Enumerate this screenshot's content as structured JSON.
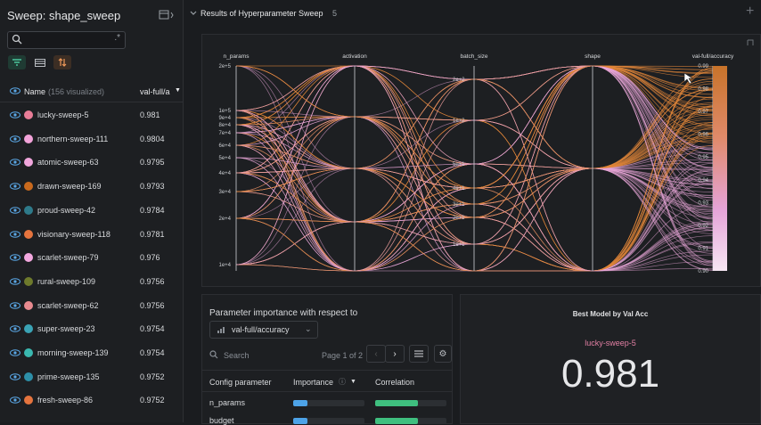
{
  "sidebar": {
    "title": "Sweep: shape_sweep",
    "col_name": "Name",
    "col_visualized": "(156 visualized)",
    "col_metric": "val-full/a",
    "runs": [
      {
        "name": "lucky-sweep-5",
        "value": "0.981",
        "color": "#e87d97"
      },
      {
        "name": "northern-sweep-111",
        "value": "0.9804",
        "color": "#f2a3d9"
      },
      {
        "name": "atomic-sweep-63",
        "value": "0.9795",
        "color": "#f0a6dc"
      },
      {
        "name": "drawn-sweep-169",
        "value": "0.9793",
        "color": "#c8691d"
      },
      {
        "name": "proud-sweep-42",
        "value": "0.9784",
        "color": "#2e7a8a"
      },
      {
        "name": "visionary-sweep-118",
        "value": "0.9781",
        "color": "#e5743e"
      },
      {
        "name": "scarlet-sweep-79",
        "value": "0.976",
        "color": "#f3a8df"
      },
      {
        "name": "rural-sweep-109",
        "value": "0.9756",
        "color": "#6e7a2c"
      },
      {
        "name": "scarlet-sweep-62",
        "value": "0.9756",
        "color": "#e88a8f"
      },
      {
        "name": "super-sweep-23",
        "value": "0.9754",
        "color": "#3aa3b5"
      },
      {
        "name": "morning-sweep-139",
        "value": "0.9754",
        "color": "#3ab8b0"
      },
      {
        "name": "prime-sweep-135",
        "value": "0.9752",
        "color": "#2d8fa8"
      },
      {
        "name": "fresh-sweep-86",
        "value": "0.9752",
        "color": "#e5743e"
      }
    ]
  },
  "main": {
    "section_title": "Results of Hyperparameter Sweep",
    "section_count": "5"
  },
  "parallel_coords": {
    "axes": [
      "n_params",
      "activation",
      "batch_size",
      "shape",
      "val-full/accuracy"
    ],
    "n_params_ticks": [
      "2e+5",
      "1e+5",
      "9e+4",
      "8e+4",
      "7e+4",
      "6e+4",
      "5e+4",
      "4e+4",
      "3e+4",
      "2e+4",
      "1e+4"
    ],
    "batch_size_ticks": [
      "2e+2",
      "1e+2",
      "5e+1",
      "4e+1",
      "3e+1",
      "2e+1",
      "1e+1"
    ],
    "accuracy_ticks": [
      "0.99",
      "0.98",
      "0.97",
      "0.96",
      "0.95",
      "0.94",
      "0.93",
      "0.92",
      "0.91",
      "0.90"
    ]
  },
  "importance": {
    "title": "Parameter importance with respect to",
    "metric": "val-full/accuracy",
    "search_placeholder": "Search",
    "page": "Page 1 of 2",
    "col_param": "Config parameter",
    "col_importance": "Importance",
    "col_correlation": "Correlation",
    "rows": [
      {
        "param": "n_params",
        "importance": 0.2,
        "correlation": 0.6
      },
      {
        "param": "budget",
        "importance": 0.2,
        "correlation": 0.6
      }
    ]
  },
  "best_model": {
    "title": "Best Model by Val Acc",
    "run": "lucky-sweep-5",
    "value": "0.981"
  },
  "colors": {
    "accent_orange": "#e08a3c",
    "accent_pink": "#f0a6dc",
    "accent_blue": "#4da3e8",
    "accent_green": "#3fbf7f"
  }
}
